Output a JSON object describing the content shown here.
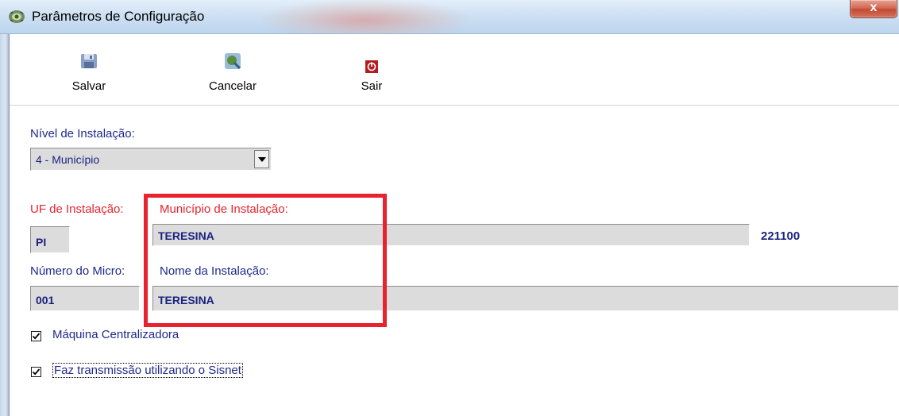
{
  "window": {
    "title": "Parâmetros de Configuração",
    "close_glyph": "x",
    "app_icon": "gear-icon"
  },
  "toolbar": {
    "save_label": "Salvar",
    "save_icon": "save-disk-icon",
    "cancel_label": "Cancelar",
    "cancel_icon": "cancel-icon",
    "exit_label": "Sair",
    "exit_icon": "exit-power-icon"
  },
  "form": {
    "nivel_label": "Nível de Instalação:",
    "nivel_value": "4 - Município",
    "uf_label": "UF de Instalação:",
    "uf_value": "PI",
    "municipio_label": "Município de Instalação:",
    "municipio_value": "TERESINA",
    "municipio_code": "221100",
    "numero_label": "Número do Micro:",
    "numero_value": "001",
    "nome_label": "Nome da Instalação:",
    "nome_value": "TERESINA"
  },
  "checkboxes": [
    {
      "label": "Máquina Centralizadora",
      "checked": true
    },
    {
      "label": "Faz transmissão utilizando o Sisnet",
      "checked": true
    }
  ],
  "colors": {
    "label_blue": "#1f2a8c",
    "label_red": "#e8232d",
    "highlight_box": "#e8232d",
    "field_bg": "#dcdcdc"
  }
}
